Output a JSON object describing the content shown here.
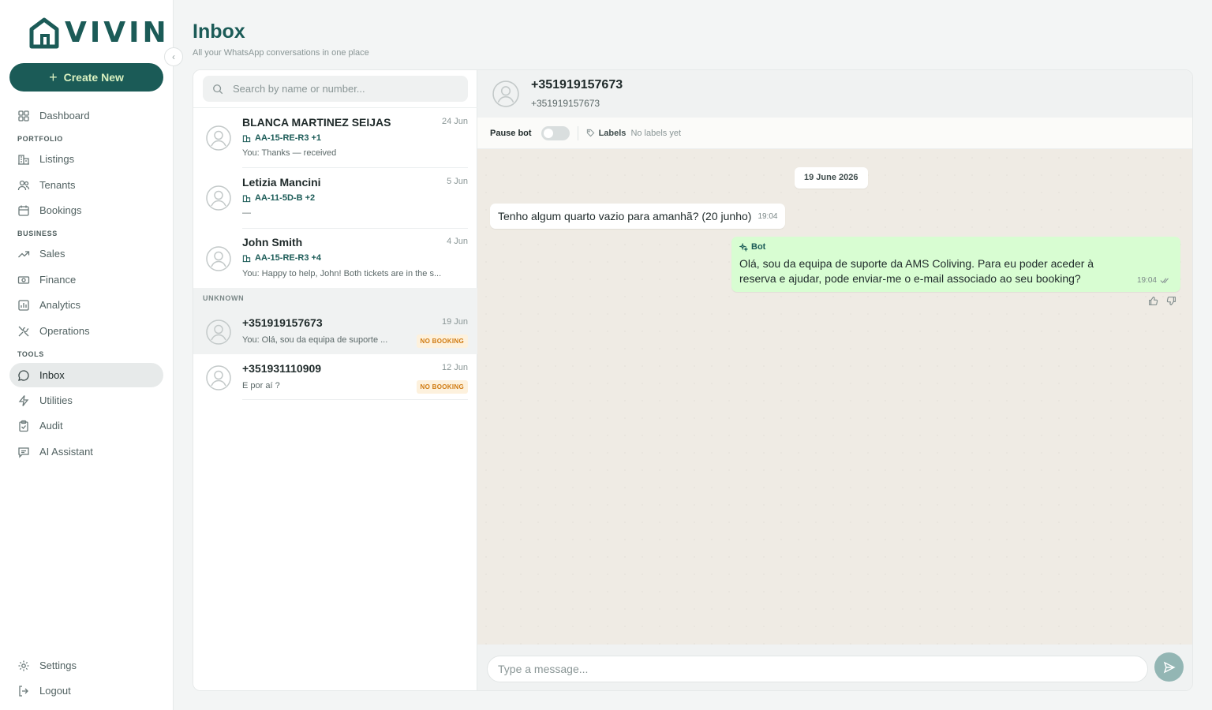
{
  "brand": {
    "logo_text": "VIVIN",
    "accent": "#1b5b57"
  },
  "sidebar": {
    "create_label": "Create New",
    "dashboard": "Dashboard",
    "sections": {
      "portfolio": "PORTFOLIO",
      "business": "BUSINESS",
      "tools": "TOOLS"
    },
    "items": {
      "listings": "Listings",
      "tenants": "Tenants",
      "bookings": "Bookings",
      "sales": "Sales",
      "finance": "Finance",
      "analytics": "Analytics",
      "operations": "Operations",
      "inbox": "Inbox",
      "utilities": "Utilities",
      "audit": "Audit",
      "ai_assistant": "AI Assistant"
    },
    "settings": "Settings",
    "logout": "Logout"
  },
  "header": {
    "title": "Inbox",
    "subtitle": "All your WhatsApp conversations in one place"
  },
  "search": {
    "placeholder": "Search by name or number..."
  },
  "conversations": [
    {
      "name": "BLANCA MARTINEZ SEIJAS",
      "date": "24 Jun",
      "tag": "AA-15-RE-R3 +1",
      "preview": "You: Thanks — received"
    },
    {
      "name": "Letizia Mancini",
      "date": "5 Jun",
      "tag": "AA-11-5D-B +2",
      "preview": "—"
    },
    {
      "name": "John Smith",
      "date": "4 Jun",
      "tag": "AA-15-RE-R3 +4",
      "preview": "You: Happy to help, John! Both tickets are in the s..."
    }
  ],
  "unknown_section": "UNKNOWN",
  "unknown_conversations": [
    {
      "name": "+351919157673",
      "date": "19 Jun",
      "preview": "You: Olá, sou da equipa de suporte ...",
      "badge": "NO BOOKING"
    },
    {
      "name": "+351931110909",
      "date": "12 Jun",
      "preview": "E por aí ?",
      "badge": "NO BOOKING"
    }
  ],
  "chat": {
    "title": "+351919157673",
    "subtitle": "+351919157673",
    "pause_label": "Pause bot",
    "labels_label": "Labels",
    "labels_empty": "No labels yet",
    "date_divider": "19 June 2026",
    "incoming": {
      "text": "Tenho algum quarto vazio para amanhã? (20 junho)",
      "time": "19:04"
    },
    "outgoing": {
      "sender": "Bot",
      "line1": "Olá, sou da equipa de suporte da AMS Coliving. Para eu poder aceder à",
      "line2": "reserva e ajudar, pode enviar-me o e-mail associado ao seu booking?",
      "time": "19:04"
    },
    "composer_placeholder": "Type a message..."
  }
}
